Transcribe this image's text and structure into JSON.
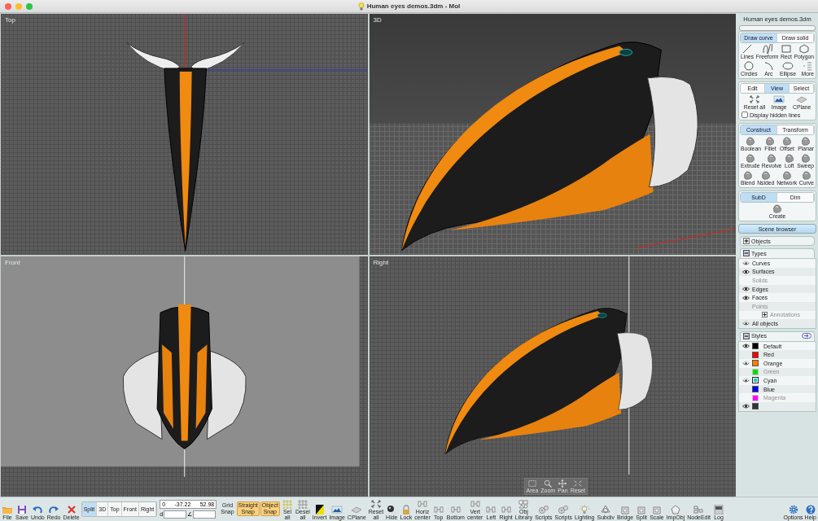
{
  "window": {
    "title": "Human eyes demos.3dm - MoI"
  },
  "viewports": [
    {
      "label": "Top",
      "kind": "top"
    },
    {
      "label": "3D",
      "kind": "perspective"
    },
    {
      "label": "Front",
      "kind": "front"
    },
    {
      "label": "Right",
      "kind": "right",
      "navigator": [
        "Area",
        "Zoom",
        "Pan",
        "Reset"
      ]
    }
  ],
  "side_panel": {
    "file_name": "Human eyes demos.3dm",
    "palettes": [
      {
        "tabs": [
          {
            "label": "Draw curve",
            "selected": true
          },
          {
            "label": "Draw solid",
            "selected": false
          }
        ],
        "tools": [
          "Lines",
          "Freeform",
          "Rect",
          "Polygon",
          "Circles",
          "Arc",
          "Ellipse",
          "More"
        ]
      },
      {
        "tabs": [
          {
            "label": "Edit",
            "selected": false
          },
          {
            "label": "View",
            "selected": true
          },
          {
            "label": "Select",
            "selected": false
          }
        ],
        "tools": [
          "Reset all",
          "Image",
          "CPlane"
        ],
        "checkbox": {
          "label": "Display hidden lines",
          "checked": false
        }
      },
      {
        "tabs": [
          {
            "label": "Construct",
            "selected": true
          },
          {
            "label": "Transform",
            "selected": false
          }
        ],
        "tools": [
          "Boolean",
          "Fillet",
          "Offset",
          "Planar",
          "Extrude",
          "Revolve",
          "Loft",
          "Sweep",
          "Blend",
          "Nsided",
          "Network",
          "Curve"
        ]
      },
      {
        "tabs": [
          {
            "label": "SubD",
            "selected": true
          },
          {
            "label": "Dim",
            "selected": false
          }
        ],
        "tools": [
          "Create"
        ]
      }
    ],
    "scene_browser": {
      "label": "Scene browser",
      "sections": [
        {
          "label": "Objects",
          "expanded": false
        },
        {
          "label": "Types",
          "expanded": true,
          "items": [
            {
              "kind": "type",
              "label": "Curves",
              "visible": true,
              "partial": true,
              "disabled": false
            },
            {
              "kind": "type",
              "label": "Surfaces",
              "visible": true,
              "partial": false,
              "disabled": false
            },
            {
              "kind": "type",
              "label": "Solids",
              "visible": false,
              "disabled": true
            },
            {
              "kind": "type",
              "label": "Edges",
              "visible": true,
              "partial": false,
              "disabled": false
            },
            {
              "kind": "type",
              "label": "Faces",
              "visible": true,
              "partial": false,
              "disabled": false
            },
            {
              "kind": "type",
              "label": "Points",
              "visible": false,
              "disabled": true
            },
            {
              "kind": "group",
              "label": "Annotations",
              "visible": false,
              "disabled": true
            },
            {
              "kind": "type",
              "label": "All objects",
              "visible": true,
              "partial": true,
              "disabled": false
            }
          ]
        },
        {
          "label": "Styles",
          "expanded": true,
          "items": [
            {
              "label": "Default",
              "color": "#000000",
              "visible": true,
              "partial": false,
              "disabled": false,
              "selected": false
            },
            {
              "label": "Red",
              "color": "#ff0000",
              "visible": false,
              "disabled": false,
              "selected": false
            },
            {
              "label": "Orange",
              "color": "#ff8000",
              "visible": true,
              "partial": true,
              "disabled": false,
              "selected": false
            },
            {
              "label": "Green",
              "color": "#00dd00",
              "visible": false,
              "disabled": true,
              "selected": false
            },
            {
              "label": "Cyan",
              "color": "#00cccc",
              "visible": true,
              "partial": true,
              "disabled": false,
              "selected": true
            },
            {
              "label": "Blue",
              "color": "#0000ff",
              "visible": false,
              "disabled": false,
              "selected": false
            },
            {
              "label": "Magenta",
              "color": "#ff00ff",
              "visible": false,
              "disabled": true,
              "selected": false
            },
            {
              "color": "#333333",
              "visible": true,
              "partial": false,
              "disabled": false,
              "selected": false
            }
          ]
        }
      ]
    }
  },
  "toolbar": {
    "items": [
      {
        "kind": "button",
        "label": "File"
      },
      {
        "kind": "button",
        "label": "Save"
      },
      {
        "kind": "button",
        "label": "Undo"
      },
      {
        "kind": "button",
        "label": "Redo"
      },
      {
        "kind": "button",
        "label": "Delete"
      },
      {
        "kind": "views",
        "items": [
          {
            "label": "Split",
            "selected": true
          },
          {
            "label": "3D",
            "selected": false
          },
          {
            "label": "Top",
            "selected": false
          },
          {
            "label": "Front",
            "selected": false
          },
          {
            "label": "Right",
            "selected": false
          }
        ]
      },
      {
        "kind": "coords",
        "values": [
          "0",
          "-37.22",
          "52.98"
        ],
        "distance_label": "d",
        "angle_label": "∠"
      },
      {
        "kind": "toggle",
        "label": "Grid Snap",
        "on": false
      },
      {
        "kind": "toggle",
        "label": "Straight Snap",
        "on": true
      },
      {
        "kind": "toggle",
        "label": "Object Snap",
        "on": true
      },
      {
        "kind": "button",
        "label": "Sel all"
      },
      {
        "kind": "button",
        "label": "Desel all"
      },
      {
        "kind": "button",
        "label": "Invert"
      },
      {
        "kind": "button",
        "label": "Image"
      },
      {
        "kind": "button",
        "label": "CPlane"
      },
      {
        "kind": "button",
        "label": "Reset all"
      },
      {
        "kind": "button",
        "label": "Hide"
      },
      {
        "kind": "button",
        "label": "Lock"
      },
      {
        "kind": "button",
        "label": "Horiz center"
      },
      {
        "kind": "button",
        "label": "Top"
      },
      {
        "kind": "button",
        "label": "Bottom"
      },
      {
        "kind": "button",
        "label": "Vert center"
      },
      {
        "kind": "button",
        "label": "Left"
      },
      {
        "kind": "button",
        "label": "Right"
      },
      {
        "kind": "button",
        "label": "Obj Library"
      },
      {
        "kind": "button",
        "label": "Scripts"
      },
      {
        "kind": "button",
        "label": "Scripts"
      },
      {
        "kind": "button",
        "label": "Lighting"
      },
      {
        "kind": "button",
        "label": "Subdiv"
      },
      {
        "kind": "button",
        "label": "Bridge"
      },
      {
        "kind": "button",
        "label": "Split"
      },
      {
        "kind": "button",
        "label": "Scale"
      },
      {
        "kind": "button",
        "label": "ImpObj"
      },
      {
        "kind": "button",
        "label": "NodeEdit"
      },
      {
        "kind": "button",
        "label": "Log"
      }
    ],
    "end_items": [
      {
        "kind": "button",
        "label": "Options"
      },
      {
        "kind": "button",
        "label": "Help"
      }
    ]
  }
}
